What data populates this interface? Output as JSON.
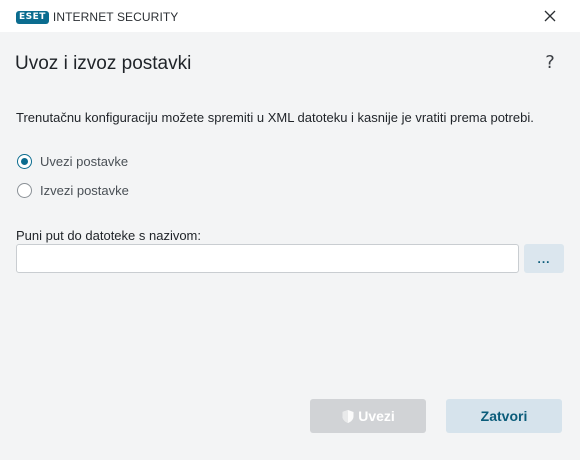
{
  "titlebar": {
    "brand": "ESET",
    "product": "INTERNET SECURITY",
    "close_icon": "close-icon"
  },
  "header": {
    "title": "Uvoz i izvoz postavki",
    "help_label": "?"
  },
  "main": {
    "description": "Trenutačnu konfiguraciju možete spremiti u XML datoteku i kasnije je vratiti prema potrebi.",
    "options": [
      {
        "label": "Uvezi postavke",
        "selected": true
      },
      {
        "label": "Izvezi postavke",
        "selected": false
      }
    ],
    "path_label": "Puni put do datoteke s nazivom:",
    "path_value": "",
    "path_placeholder": "",
    "browse_label": "..."
  },
  "footer": {
    "import_label": "Uvezi",
    "import_enabled": false,
    "import_icon": "shield-icon",
    "close_label": "Zatvori"
  },
  "colors": {
    "accent": "#0b6c8f",
    "panel_bg": "#f3f4f5",
    "disabled_button": "#d1d3d6",
    "secondary_button": "#d6e3ec"
  }
}
